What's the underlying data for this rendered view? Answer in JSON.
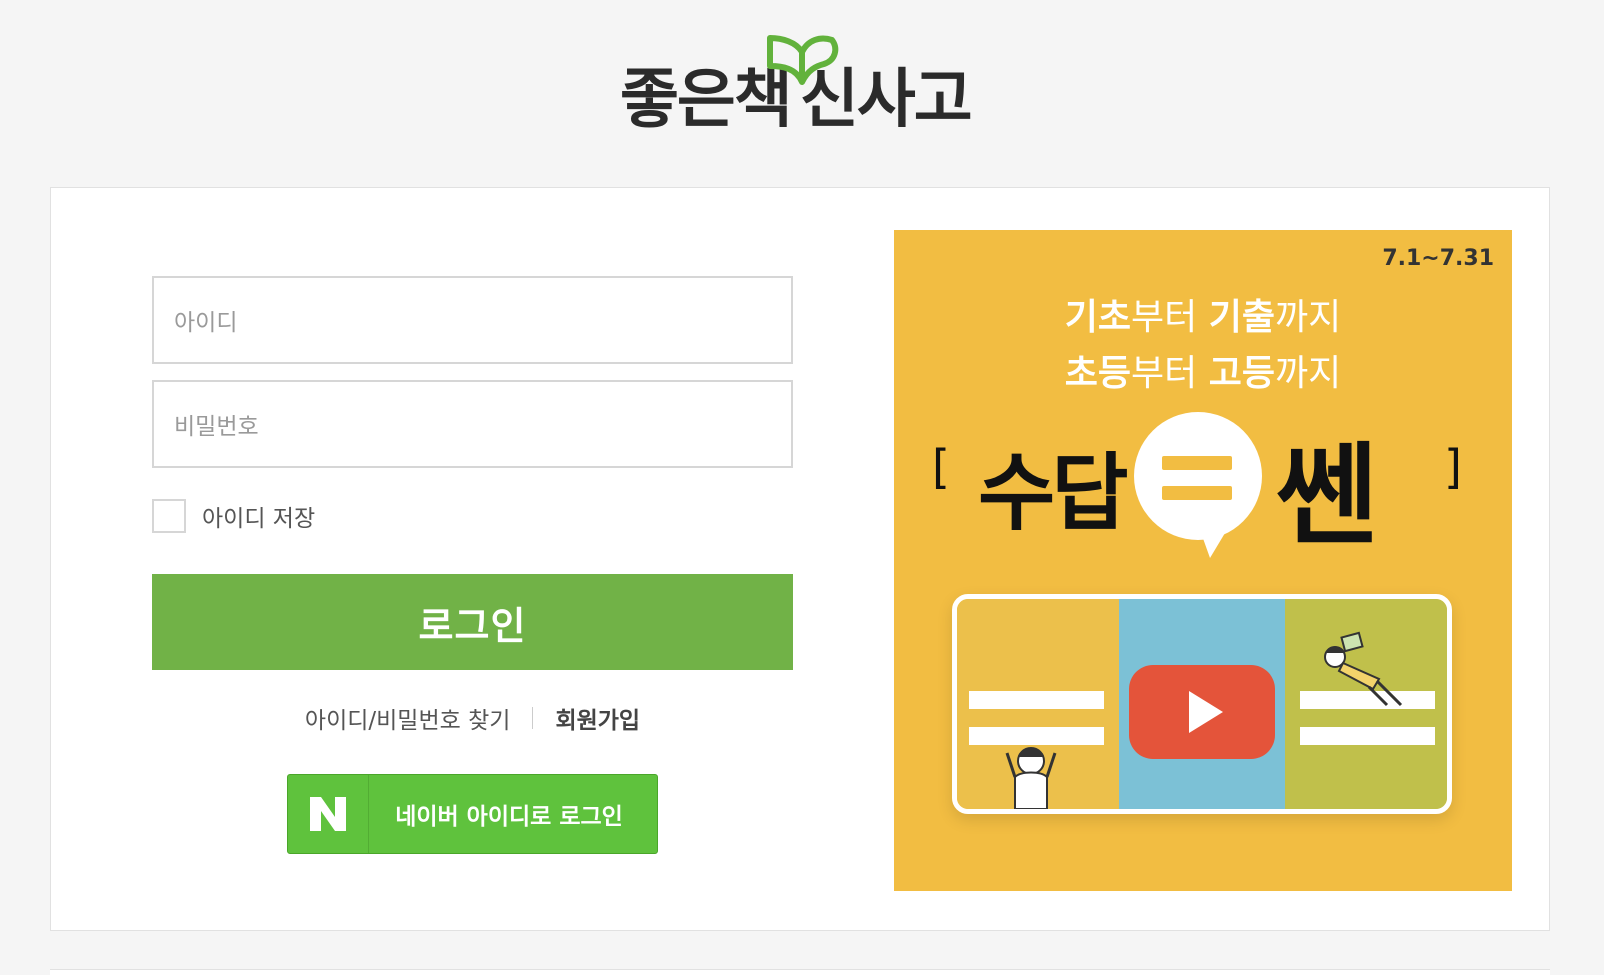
{
  "logo": {
    "text_left": "좋은책",
    "text_right": "신사고",
    "icon": "book-leaf-icon",
    "color": "#2b2b2b",
    "accent": "#62b23c"
  },
  "login": {
    "id_placeholder": "아이디",
    "pw_placeholder": "비밀번호",
    "remember_label": "아이디 저장",
    "submit_label": "로그인",
    "find_label": "아이디/비밀번호 찾기",
    "signup_label": "회원가입",
    "naver_letter": "N",
    "naver_label": "네이버 아이디로 로그인",
    "accent": "#71b247",
    "naver_color": "#5fc23d"
  },
  "banner": {
    "period": "7.1~7.31",
    "line1_bold1": "기초",
    "line1_light1": "부터 ",
    "line1_bold2": "기출",
    "line1_light2": "까지",
    "line2_bold1": "초등",
    "line2_light1": "부터 ",
    "line2_bold2": "고등",
    "line2_light2": "까지",
    "brand_left": "수답",
    "brand_right": "쎈",
    "bracket_open": "[",
    "bracket_close": "]",
    "background": "#f2bd42"
  }
}
